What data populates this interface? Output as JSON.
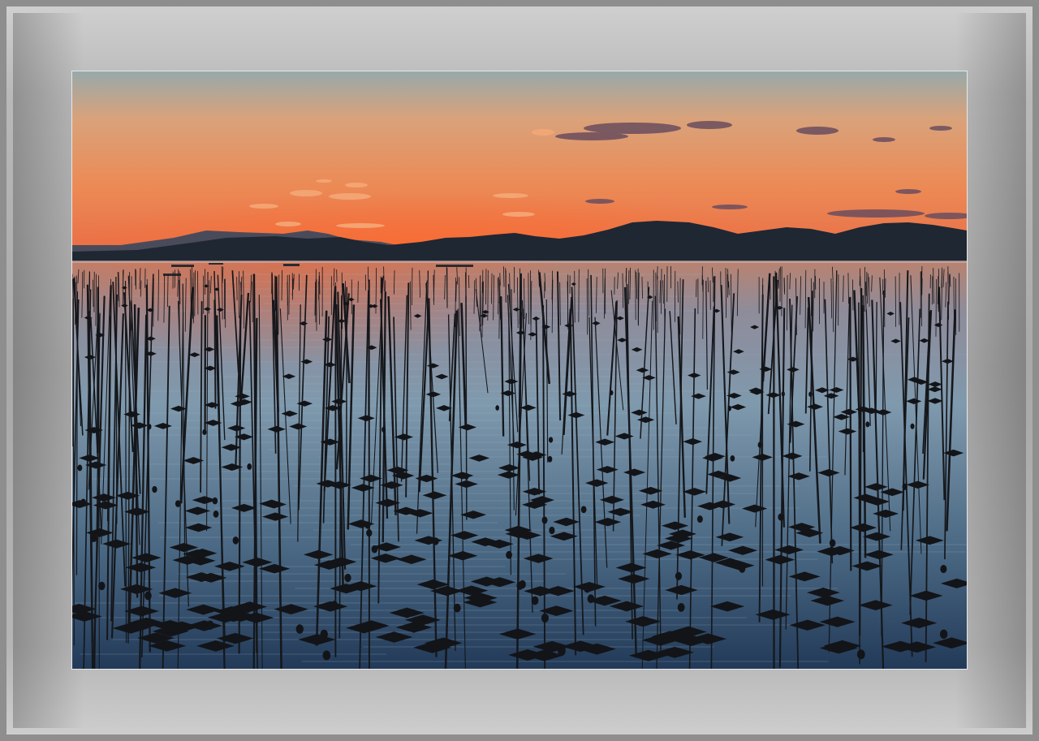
{
  "image": {
    "subject": "sunset-over-seaweed-farm",
    "colors": {
      "sky_top": "#8fa3a8",
      "sky_mid": "#e58d55",
      "sky_horizon": "#e8653a",
      "mountains": "#1e2630",
      "water_top": "#c7876a",
      "water_mid": "#6f8ea6",
      "water_bottom": "#27415e",
      "poles": "#14161a",
      "frame_light": "#cfcfcf",
      "frame_dark": "#8e8e8e"
    }
  }
}
